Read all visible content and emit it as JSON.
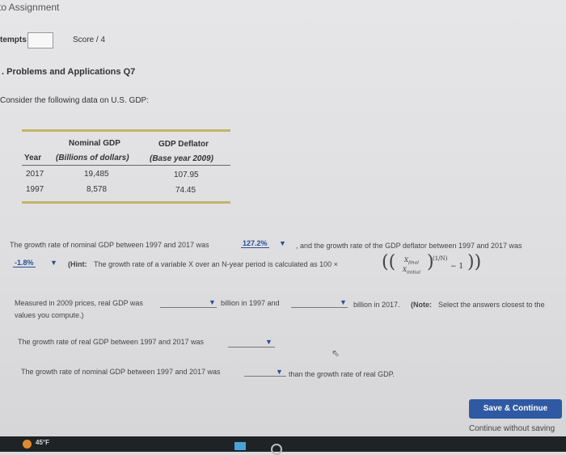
{
  "header": {
    "back_link": "to Assignment",
    "attempts_label": "tempts",
    "attempts_value": "",
    "score": "Score / 4"
  },
  "section_title": ". Problems and Applications Q7",
  "intro": "Consider the following data on U.S. GDP:",
  "table": {
    "col1_header": "Year",
    "col2_header_line1": "Nominal GDP",
    "col2_header_line2": "(Billions of dollars)",
    "col3_header_line1": "GDP Deflator",
    "col3_header_line2": "(Base year 2009)",
    "rows": [
      {
        "year": "2017",
        "nominal": "19,485",
        "deflator": "107.95"
      },
      {
        "year": "1997",
        "nominal": "8,578",
        "deflator": "74.45"
      }
    ]
  },
  "q1": {
    "text_a": "The growth rate of nominal GDP between 1997 and 2017 was",
    "answer_a": "127.2%",
    "text_b": ", and the growth rate of the GDP deflator between 1997 and 2017 was",
    "answer_b": "-1.8%",
    "hint_label": "(Hint:",
    "hint_text": "The growth rate of a variable X over an N-year period is calculated as 100 ×"
  },
  "q2": {
    "text_a": "Measured in 2009 prices, real GDP was",
    "text_b": "billion in 1997 and",
    "text_c": "billion in 2017.",
    "note_label": "(Note:",
    "note_text": "Select the answers closest to the",
    "text_d": "values you compute.)"
  },
  "q3": {
    "text": "The growth rate of real GDP between 1997 and 2017 was"
  },
  "q4": {
    "text_a": "The growth rate of nominal GDP between 1997 and 2017 was",
    "text_b": "than the growth rate of real GDP."
  },
  "actions": {
    "save_label": "Save & Continue",
    "continue_label": "Continue without saving"
  },
  "taskbar": {
    "temperature": "45°F"
  },
  "colors": {
    "accent": "#2f5aa3",
    "answer": "#2a4f96",
    "rule": "#c4b46a"
  }
}
